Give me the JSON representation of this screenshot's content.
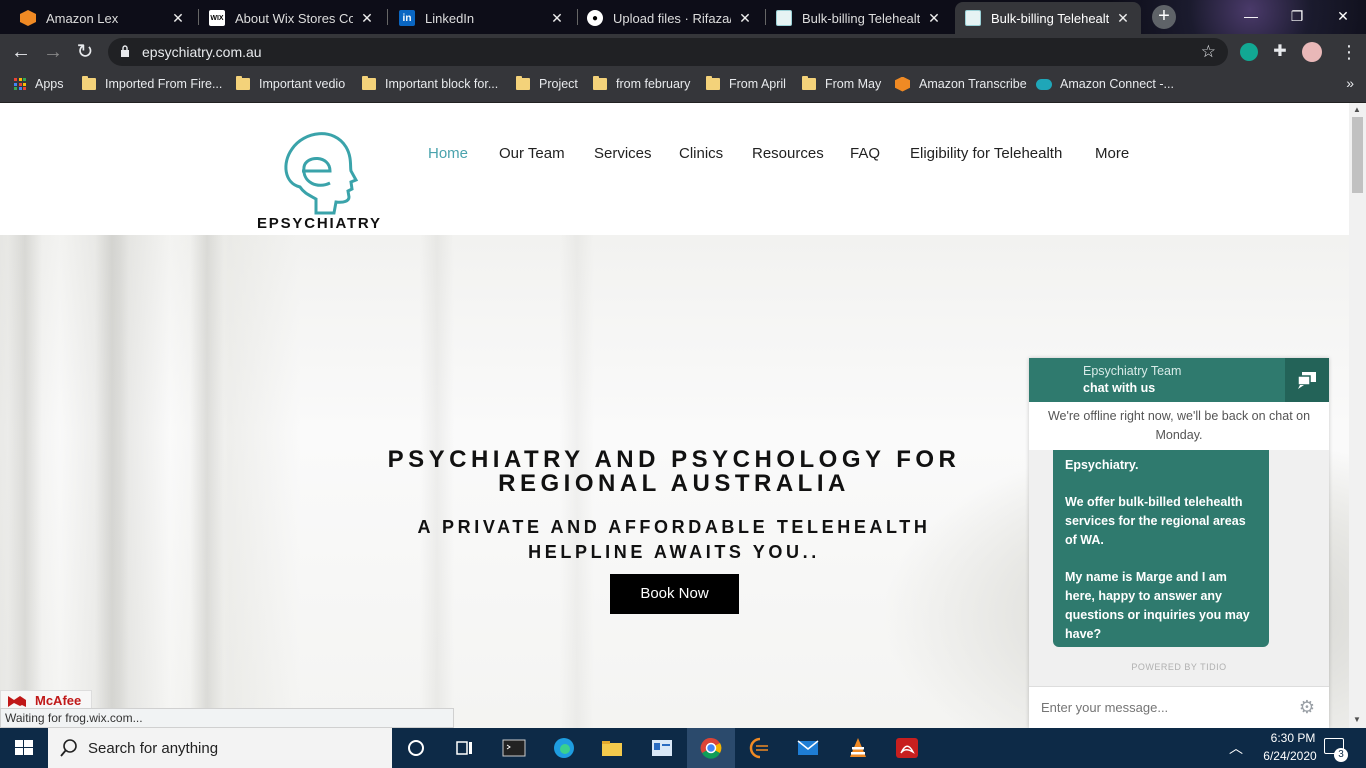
{
  "browser": {
    "tabs": [
      {
        "label": "Amazon Lex",
        "icon": "amazon-icon",
        "color": "#f08a24"
      },
      {
        "label": "About Wix Stores Coup",
        "icon": "wix-icon",
        "color": "#ffffff"
      },
      {
        "label": "LinkedIn",
        "icon": "linkedin-icon",
        "color": "#0a66c2"
      },
      {
        "label": "Upload files · Rifaza/Ep",
        "icon": "github-icon",
        "color": "#ffffff"
      },
      {
        "label": "Bulk-billing Telehealth",
        "icon": "site-icon",
        "color": "#9ad0d6"
      },
      {
        "label": "Bulk-billing Telehealth",
        "icon": "site-icon",
        "color": "#9ad0d6"
      }
    ],
    "url": "epsychiatry.com.au",
    "bookmarks": [
      {
        "label": "Apps",
        "icon": "apps-grid-icon"
      },
      {
        "label": "Imported From Fire...",
        "icon": "folder-icon"
      },
      {
        "label": "Important vedio",
        "icon": "folder-icon"
      },
      {
        "label": "Important block for...",
        "icon": "folder-icon"
      },
      {
        "label": "Project",
        "icon": "folder-icon"
      },
      {
        "label": "from february",
        "icon": "folder-icon"
      },
      {
        "label": "From April",
        "icon": "folder-icon"
      },
      {
        "label": "From May",
        "icon": "folder-icon"
      },
      {
        "label": "Amazon Transcribe",
        "icon": "amazon-icon"
      },
      {
        "label": "Amazon Connect -...",
        "icon": "cloud-icon"
      }
    ]
  },
  "site": {
    "logo_text": "EPSYCHIATRY",
    "nav": [
      "Home",
      "Our Team",
      "Services",
      "Clinics",
      "Resources",
      "FAQ",
      "Eligibility for Telehealth",
      "More"
    ],
    "accent_color": "#4aa3ad",
    "hero": {
      "title_line1": "PSYCHIATRY AND PSYCHOLOGY FOR",
      "title_line2": "REGIONAL AUSTRALIA",
      "sub_line1": "A PRIVATE AND AFFORDABLE TELEHEALTH",
      "sub_line2": "HELPLINE AWAITS YOU..",
      "button": "Book Now"
    }
  },
  "chat": {
    "team": "Epsychiatry Team",
    "cta": "chat with us",
    "offline": "We're offline right now, we'll be back on chat on Monday.",
    "message_p1": "Epsychiatry.",
    "message_p2": "We offer bulk-billed telehealth services for the regional areas of WA.",
    "message_p3": "My name is Marge and I am here, happy to answer any questions or inquiries you may have?",
    "powered": "POWERED BY TIDIO",
    "input_placeholder": "Enter your message...",
    "header_color": "#2f7a6e"
  },
  "status": {
    "mcafee": "McAfee",
    "loading": "Waiting for frog.wix.com..."
  },
  "taskbar": {
    "search_placeholder": "Search for anything",
    "time": "6:30 PM",
    "date": "6/24/2020",
    "notifications": "3"
  }
}
